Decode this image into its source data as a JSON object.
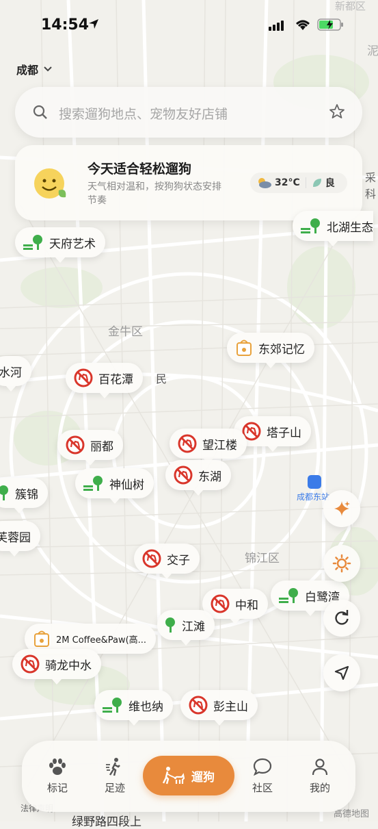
{
  "status_bar": {
    "time": "14:54"
  },
  "location": {
    "city": "成都"
  },
  "search": {
    "placeholder": "搜索遛狗地点、宠物友好店铺"
  },
  "weather_card": {
    "title": "今天适合轻松遛狗",
    "subtitle": "天气相对温和，按狗狗状态安排节奏",
    "temperature": "32°C",
    "air_quality": "良"
  },
  "map_labels": {
    "district_jinniu": "金牛区",
    "district_jinjiang": "锦江区",
    "station": "成都东站",
    "top_right": "新都区",
    "top_right2": "泥",
    "partial_right": "采科",
    "bottom_partial": "绿野路四段上",
    "legal": "法律声明",
    "amap": "高德地图",
    "under_baihuatan": "民"
  },
  "pins": [
    {
      "label": "天府艺术",
      "type": "park"
    },
    {
      "label": "北湖生态",
      "type": "park"
    },
    {
      "label": "东郊记忆",
      "type": "shop"
    },
    {
      "label": "水河",
      "type": "none"
    },
    {
      "label": "百花潭",
      "type": "nodog"
    },
    {
      "label": "塔子山",
      "type": "nodog"
    },
    {
      "label": "丽都",
      "type": "nodog"
    },
    {
      "label": "望江楼",
      "type": "nodog"
    },
    {
      "label": "东湖",
      "type": "nodog"
    },
    {
      "label": "神仙树",
      "type": "park"
    },
    {
      "label": "簇锦",
      "type": "park"
    },
    {
      "label": "芙蓉园",
      "type": "none"
    },
    {
      "label": "交子",
      "type": "nodog"
    },
    {
      "label": "中和",
      "type": "nodog"
    },
    {
      "label": "白鹭湾",
      "type": "park"
    },
    {
      "label": "江滩",
      "type": "park"
    },
    {
      "label": "2M Coffee&Paw(高...",
      "type": "shop"
    },
    {
      "label": "骑龙中水",
      "type": "nodog"
    },
    {
      "label": "维也纳",
      "type": "park"
    },
    {
      "label": "彭主山",
      "type": "nodog"
    }
  ],
  "tabs": {
    "mark": "标记",
    "footprint": "足迹",
    "walk": "遛狗",
    "community": "社区",
    "mine": "我的"
  },
  "colors": {
    "accent": "#e88a3c",
    "park_green": "#3fae4b",
    "nodog_red": "#d9362b"
  }
}
